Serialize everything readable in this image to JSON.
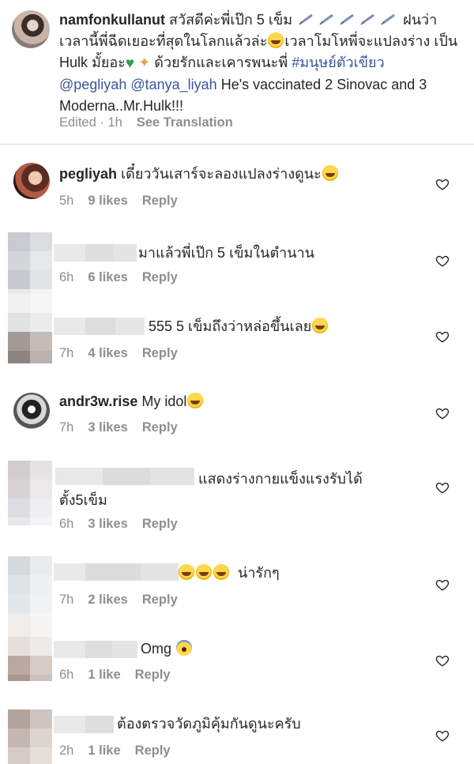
{
  "caption": {
    "username": "namfonkullanut",
    "text_1": " สวัสดีค่ะพี่เป๊ก 5 เข็ม",
    "text_2": " ฝนว่า เวลานี้พี่ฉีดเยอะที่สุดในโลกแล้วล่ะ",
    "text_3": "เวลาโมโหพี่จะแปลงร่าง เป็น Hulk มั้ยอะ",
    "text_4": " ด้วยรักและเคารพนะพี่ ",
    "hashtag": "#มนุษย์ตัวเขียว",
    "mention_1": "@pegliyah",
    "mention_2": "@tanya_liyah",
    "text_5": " He's vaccinated 2 Sinovac and 3 Moderna..Mr.Hulk!!!",
    "edited": "Edited · 1h",
    "see_translation": "See Translation"
  },
  "comments": [
    {
      "username": "pegliyah",
      "text": " เดี๋ยววันเสาร์จะลองแปลงร่างดูนะ",
      "time": "5h",
      "likes": "9 likes",
      "reply": "Reply"
    },
    {
      "username": "",
      "text": "มาแล้วพี่เป๊ก 5 เข็มในตำนาน",
      "time": "6h",
      "likes": "6 likes",
      "reply": "Reply"
    },
    {
      "username": "",
      "text": "555 5 เข็มถึงว่าหล่อขึ้นเลย",
      "time": "7h",
      "likes": "4 likes",
      "reply": "Reply"
    },
    {
      "username": "andr3w.rise",
      "text": " My idol",
      "time": "7h",
      "likes": "3 likes",
      "reply": "Reply"
    },
    {
      "username": "",
      "text": "แสดงร่างกายแข็งแรงรับได้ ตั้ง5เข็ม",
      "time": "6h",
      "likes": "3 likes",
      "reply": "Reply"
    },
    {
      "username": "",
      "text": "น่ารักๆ",
      "time": "7h",
      "likes": "2 likes",
      "reply": "Reply"
    },
    {
      "username": "",
      "text": "Omg",
      "time": "6h",
      "likes": "1 like",
      "reply": "Reply"
    },
    {
      "username": "",
      "text": "ต้องตรวจวัดภูมิคุ้มกันดูนะครับ",
      "time": "2h",
      "likes": "1 like",
      "reply": "Reply"
    }
  ],
  "icons": {
    "heart": "heart-outline-icon",
    "emoji_laugh": "laughing-face-icon",
    "emoji_tears": "tears-of-joy-icon",
    "emoji_scream": "screaming-face-icon",
    "syringe": "syringe-icon",
    "green_heart": "green-heart-icon",
    "pray": "folded-hands-icon"
  }
}
